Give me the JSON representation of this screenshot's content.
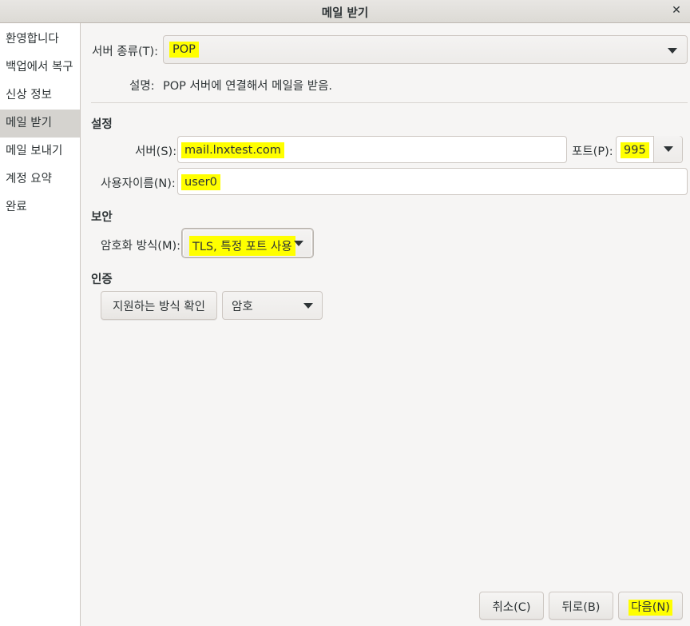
{
  "window": {
    "title": "메일 받기",
    "close_glyph": "✕"
  },
  "sidebar": {
    "items": [
      {
        "label": "환영합니다"
      },
      {
        "label": "백업에서 복구"
      },
      {
        "label": "신상 정보"
      },
      {
        "label": "메일 받기"
      },
      {
        "label": "메일 보내기"
      },
      {
        "label": "계정 요약"
      },
      {
        "label": "완료"
      }
    ],
    "active_index": 3
  },
  "server_type": {
    "label": "서버 종류(T):",
    "value": "POP"
  },
  "description": {
    "label": "설명:",
    "text": "POP 서버에 연결해서 메일을 받음."
  },
  "settings": {
    "heading": "설정",
    "server_label": "서버(S):",
    "server_value": "mail.lnxtest.com",
    "port_label": "포트(P):",
    "port_value": "995",
    "username_label": "사용자이름(N):",
    "username_value": "user0"
  },
  "security": {
    "heading": "보안",
    "encryption_label": "암호화 방식(M):",
    "encryption_value": "TLS, 특정 포트 사용"
  },
  "auth": {
    "heading": "인증",
    "check_button": "지원하는 방식 확인",
    "method_value": "암호"
  },
  "footer": {
    "cancel": "취소(C)",
    "back": "뒤로(B)",
    "next": "다음(N)"
  },
  "colors": {
    "highlight": "#ffff00",
    "sidebar_active": "#d5d3cf"
  }
}
